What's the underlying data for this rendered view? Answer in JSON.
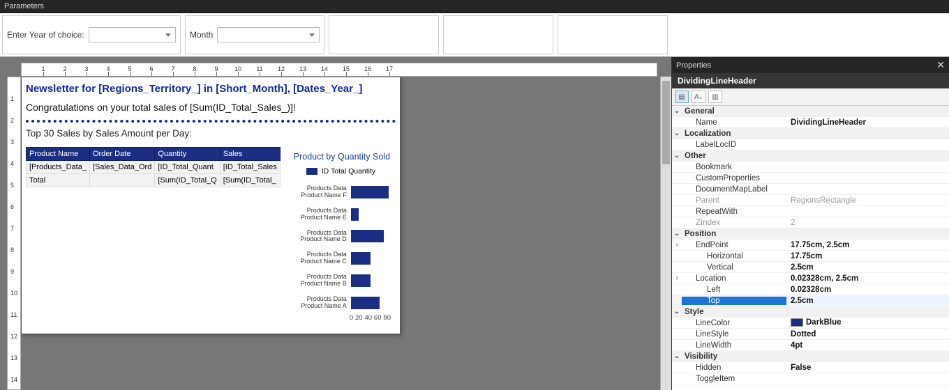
{
  "parameters": {
    "panel_title": "Parameters",
    "year_label": "Enter Year of choice:",
    "month_label": "Month"
  },
  "ruler_h": [
    "1",
    "2",
    "3",
    "4",
    "5",
    "6",
    "7",
    "8",
    "9",
    "10",
    "11",
    "12",
    "13",
    "14",
    "15",
    "16",
    "17"
  ],
  "ruler_v": [
    "1",
    "2",
    "3",
    "4",
    "5",
    "6",
    "7",
    "8",
    "9",
    "10",
    "11",
    "12",
    "13",
    "14"
  ],
  "report": {
    "title": "Newsletter for [Regions_Territory_] in [Short_Month], [Dates_Year_]",
    "congrats": "Congratulations on your total sales of [Sum(ID_Total_Sales_)]!",
    "subhead": "Top 30 Sales by Sales Amount per Day:",
    "table": {
      "headers": [
        "Product Name",
        "Order Date",
        "Quantity",
        "Sales"
      ],
      "rows": [
        [
          "[Products_Data_",
          "[Sales_Data_Ord",
          "[ID_Total_Quant",
          "[ID_Total_Sales"
        ],
        [
          "Total",
          "",
          "[Sum(ID_Total_Q",
          "[Sum(ID_Total_"
        ]
      ]
    },
    "chart": {
      "title": "Product by Quantity Sold",
      "legend": "ID Total Quantity"
    }
  },
  "chart_data": {
    "type": "bar",
    "orientation": "horizontal",
    "title": "Product by Quantity Sold",
    "xlabel": "",
    "ylabel": "",
    "xlim": [
      0,
      90
    ],
    "xticks": [
      0,
      20,
      40,
      60,
      80
    ],
    "categories": [
      "Products Data Product Name F",
      "Products Data Product Name E",
      "Products Data Product Name D",
      "Products Data Product Name C",
      "Products Data Product Name B",
      "Products Data Product Name A"
    ],
    "values": [
      85,
      18,
      75,
      45,
      45,
      65
    ],
    "series_name": "ID Total Quantity",
    "color": "#1b2e83"
  },
  "properties": {
    "panel_title": "Properties",
    "object_name": "DividingLineHeader",
    "categories": {
      "general": "General",
      "localization": "Localization",
      "other": "Other",
      "position": "Position",
      "style": "Style",
      "visibility": "Visibility"
    },
    "rows": {
      "Name": "DividingLineHeader",
      "LabelLocID": "",
      "Bookmark": "",
      "CustomProperties": "",
      "DocumentMapLabel": "",
      "Parent": "RegionsRectangle",
      "RepeatWith": "",
      "ZIndex": "2",
      "EndPoint": "17.75cm, 2.5cm",
      "Horizontal": "17.75cm",
      "Vertical": "2.5cm",
      "Location": "0.02328cm, 2.5cm",
      "Left": "0.02328cm",
      "Top": "2.5cm",
      "LineColor": "DarkBlue",
      "LineStyle": "Dotted",
      "LineWidth": "4pt",
      "Hidden": "False",
      "ToggleItem": ""
    },
    "labels": {
      "Name": "Name",
      "LabelLocID": "LabelLocID",
      "Bookmark": "Bookmark",
      "CustomProperties": "CustomProperties",
      "DocumentMapLabel": "DocumentMapLabel",
      "Parent": "Parent",
      "RepeatWith": "RepeatWith",
      "ZIndex": "ZIndex",
      "EndPoint": "EndPoint",
      "Horizontal": "Horizontal",
      "Vertical": "Vertical",
      "Location": "Location",
      "Left": "Left",
      "Top": "Top",
      "LineColor": "LineColor",
      "LineStyle": "LineStyle",
      "LineWidth": "LineWidth",
      "Hidden": "Hidden",
      "ToggleItem": "ToggleItem"
    }
  }
}
